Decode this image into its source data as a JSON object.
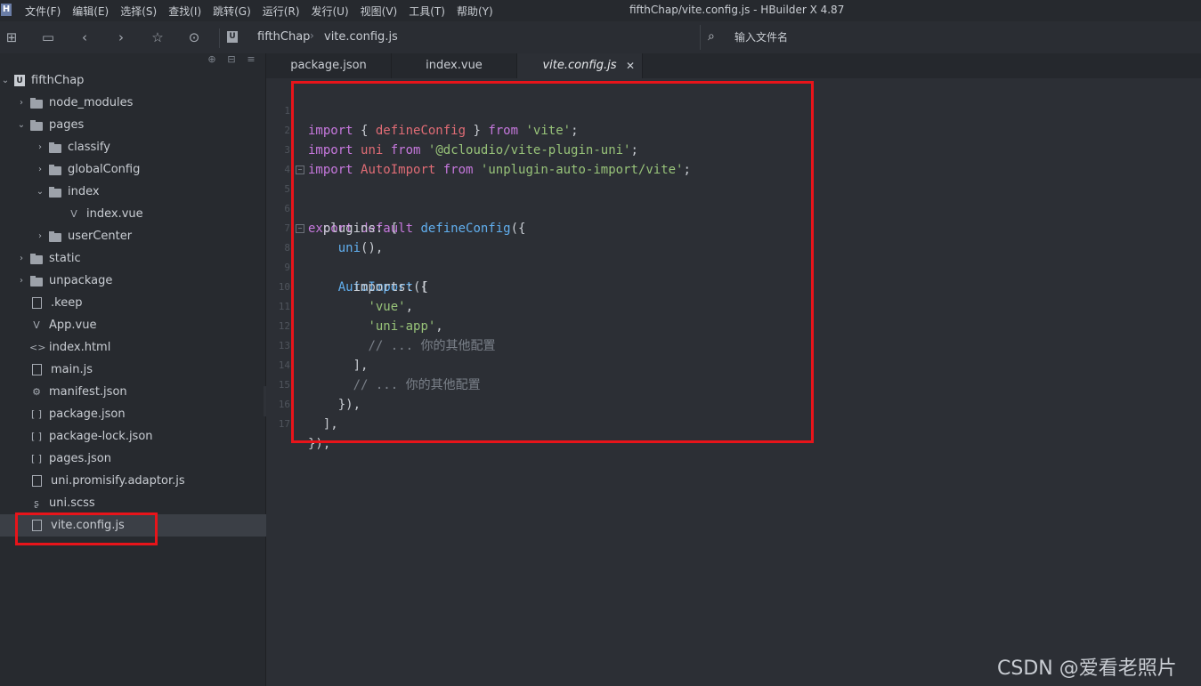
{
  "menubar": {
    "logo": "H",
    "items": [
      "文件(F)",
      "编辑(E)",
      "选择(S)",
      "查找(I)",
      "跳转(G)",
      "运行(R)",
      "发行(U)",
      "视图(V)",
      "工具(T)",
      "帮助(Y)"
    ],
    "window_title": "fifthChap/vite.config.js - HBuilder X 4.87"
  },
  "toolbar": {
    "icons": [
      "new-file-icon",
      "save-icon",
      "back-icon",
      "forward-icon",
      "star-icon",
      "run-icon"
    ],
    "breadcrumb": [
      "fifthChap",
      "vite.config.js"
    ],
    "breadcrumb_logo": "U",
    "search_placeholder": "输入文件名"
  },
  "sidebar": {
    "tree": [
      {
        "label": "fifthChap",
        "type": "project",
        "chevron": "down"
      },
      {
        "label": "node_modules",
        "type": "folder",
        "chevron": "right"
      },
      {
        "label": "pages",
        "type": "folder",
        "chevron": "down"
      },
      {
        "label": "classify",
        "type": "folder",
        "chevron": "right"
      },
      {
        "label": "globalConfig",
        "type": "folder",
        "chevron": "right"
      },
      {
        "label": "index",
        "type": "folder",
        "chevron": "down"
      },
      {
        "label": "index.vue",
        "type": "vue"
      },
      {
        "label": "userCenter",
        "type": "folder",
        "chevron": "right"
      },
      {
        "label": "static",
        "type": "folder",
        "chevron": "right"
      },
      {
        "label": "unpackage",
        "type": "folder",
        "chevron": "right"
      },
      {
        "label": ".keep",
        "type": "file"
      },
      {
        "label": "App.vue",
        "type": "vue"
      },
      {
        "label": "index.html",
        "type": "html"
      },
      {
        "label": "main.js",
        "type": "file"
      },
      {
        "label": "manifest.json",
        "type": "manifest"
      },
      {
        "label": "package.json",
        "type": "json"
      },
      {
        "label": "package-lock.json",
        "type": "json"
      },
      {
        "label": "pages.json",
        "type": "json"
      },
      {
        "label": "uni.promisify.adaptor.js",
        "type": "file"
      },
      {
        "label": "uni.scss",
        "type": "scss"
      },
      {
        "label": "vite.config.js",
        "type": "file",
        "selected": true
      }
    ]
  },
  "tabs": [
    {
      "label": "package.json",
      "active": false
    },
    {
      "label": "index.vue",
      "active": false
    },
    {
      "label": "vite.config.js",
      "active": true,
      "close": "✕"
    }
  ],
  "editor": {
    "lines": [
      "import { defineConfig } from 'vite';",
      "import uni from '@dcloudio/vite-plugin-uni';",
      "import AutoImport from 'unplugin-auto-import/vite';",
      "",
      "export default defineConfig({",
      "  plugins: [",
      "    uni(),",
      "    AutoImport({",
      "      imports: [",
      "        'vue',",
      "        'uni-app',",
      "        // ... 你的其他配置",
      "      ],",
      "      // ... 你的其他配置",
      "    }),",
      "  ],",
      "});"
    ],
    "line_numbers": [
      "1",
      "2",
      "3",
      "4",
      "5",
      "6",
      "7",
      "8",
      "9",
      "10",
      "11",
      "12",
      "13",
      "14",
      "15",
      "16",
      "17"
    ]
  },
  "colors": {
    "highlight": "#e8141a",
    "keyword": "#c678dd",
    "function": "#61afef",
    "string": "#98c379",
    "comment": "#7a8089"
  },
  "watermark": "CSDN @爱看老照片"
}
